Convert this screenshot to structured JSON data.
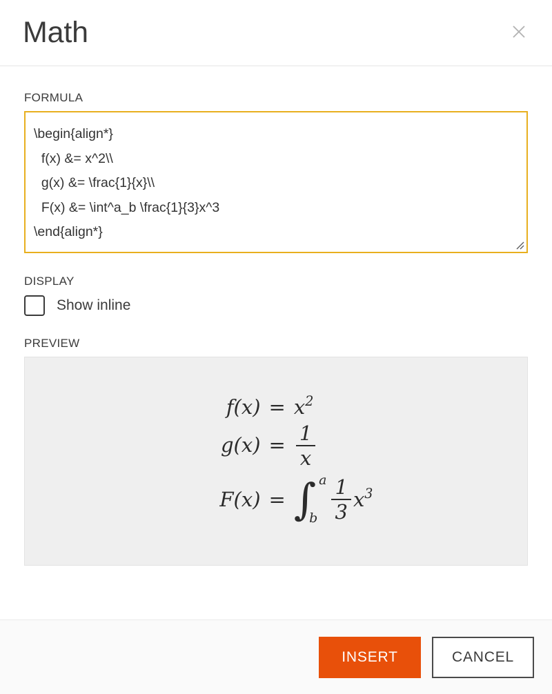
{
  "dialog": {
    "title": "Math",
    "close_icon": "close-icon"
  },
  "formula": {
    "label": "FORMULA",
    "value": "\\begin{align*}\n  f(x) &= x^2\\\\\n  g(x) &= \\frac{1}{x}\\\\\n  F(x) &= \\int^a_b \\frac{1}{3}x^3\n\\end{align*}",
    "placeholder": "",
    "border_color": "#e8af1e",
    "focused": true,
    "resize_handle_icon": "resize-grip-icon"
  },
  "display": {
    "label": "DISPLAY",
    "checkbox_label": "Show inline",
    "checked": false
  },
  "preview": {
    "label": "PREVIEW",
    "background_color": "#efefef",
    "equations": [
      {
        "lhs": "f(x)",
        "eq": "=",
        "rhs_text": "x^2",
        "base": "x",
        "superscript": "2"
      },
      {
        "lhs": "g(x)",
        "eq": "=",
        "rhs_text": "1/x",
        "numerator": "1",
        "denominator": "x"
      },
      {
        "lhs": "F(x)",
        "eq": "=",
        "rhs_text": "int_b^a (1/3) x^3",
        "integral_symbol": "∫",
        "upper_limit": "a",
        "lower_limit": "b",
        "numerator": "1",
        "denominator": "3",
        "base": "x",
        "superscript": "3"
      }
    ]
  },
  "footer": {
    "insert_label": "INSERT",
    "cancel_label": "CANCEL",
    "insert_color": "#e8500a"
  }
}
